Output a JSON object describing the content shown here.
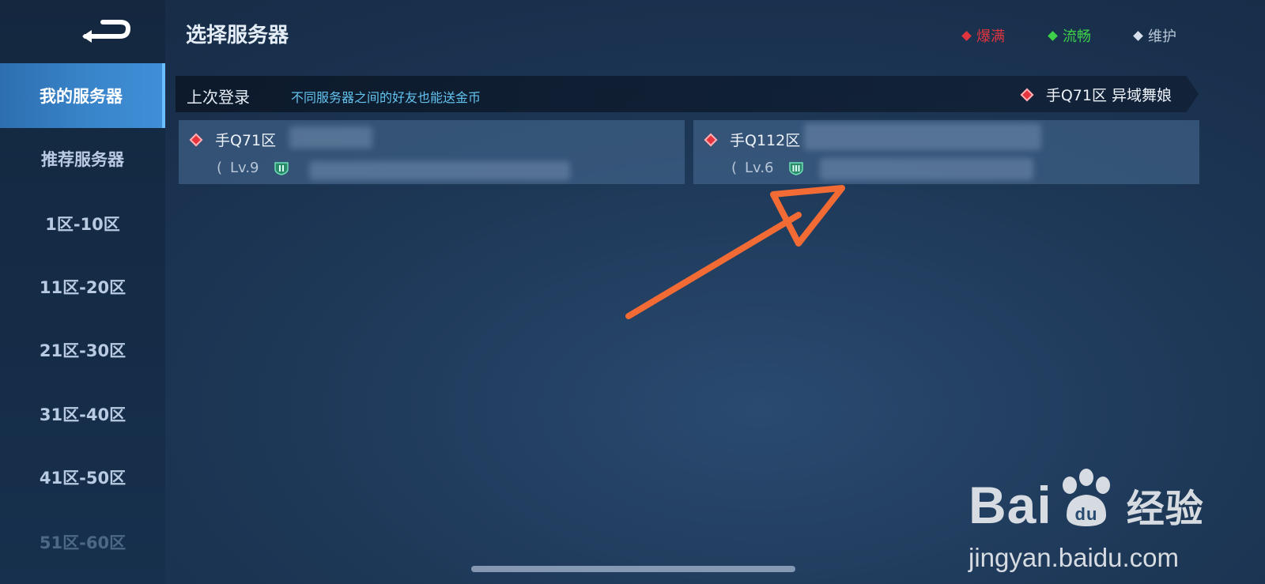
{
  "header": {
    "title": "选择服务器",
    "legend": [
      {
        "label": "爆满",
        "color": "#e0343f"
      },
      {
        "label": "流畅",
        "color": "#3fd04a"
      },
      {
        "label": "维护",
        "color": "#d6e0ec"
      }
    ]
  },
  "sidebar": {
    "items": [
      {
        "label": "我的服务器",
        "active": true
      },
      {
        "label": "推荐服务器"
      },
      {
        "label": "1区-10区"
      },
      {
        "label": "11区-20区"
      },
      {
        "label": "21区-30区"
      },
      {
        "label": "31区-40区"
      },
      {
        "label": "41区-50区"
      },
      {
        "label": "51区-60区"
      }
    ]
  },
  "banner": {
    "label": "上次登录",
    "tip": "不同服务器之间的好友也能送金币",
    "last_server": "手Q71区 异域舞娘"
  },
  "cards": [
    {
      "server": "手Q71区",
      "level_prefix": "(",
      "level": "Lv.9",
      "rank_icon": "rank-ii-badge",
      "status_color": "#e8343f"
    },
    {
      "server": "手Q112区",
      "level_prefix": "(",
      "level": "Lv.6",
      "rank_icon": "rank-iii-badge",
      "status_color": "#e8343f"
    }
  ],
  "colors": {
    "accent": "#3f8ed6",
    "tip": "#63c3ef",
    "arrow": "#f26b35"
  },
  "watermark": {
    "brand_a": "Bai",
    "brand_b": "经验",
    "paw_text": "du",
    "url": "jingyan.baidu.com"
  }
}
